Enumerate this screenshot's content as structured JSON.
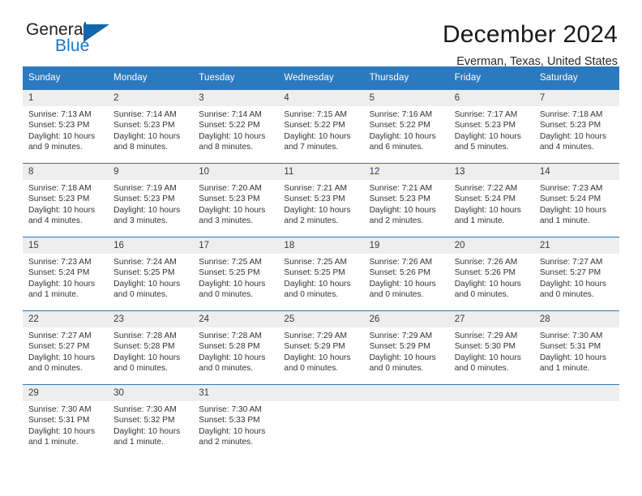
{
  "brand": {
    "name_top": "General",
    "name_bottom": "Blue",
    "accent_color": "#1878c8",
    "triangle_color": "#1266ac"
  },
  "header": {
    "title": "December 2024",
    "subtitle": "Everman, Texas, United States"
  },
  "theme": {
    "header_row_bg": "#2b79bf",
    "daynum_bg": "#eeeeee",
    "text_color": "#333333"
  },
  "weekday_headers": [
    "Sunday",
    "Monday",
    "Tuesday",
    "Wednesday",
    "Thursday",
    "Friday",
    "Saturday"
  ],
  "labels": {
    "sunrise_prefix": "Sunrise:",
    "sunset_prefix": "Sunset:",
    "daylight_prefix": "Daylight:"
  },
  "weeks": [
    {
      "days": [
        {
          "num": "1",
          "sunrise": "Sunrise: 7:13 AM",
          "sunset": "Sunset: 5:23 PM",
          "daylight_line1": "Daylight: 10 hours",
          "daylight_line2": "and 9 minutes."
        },
        {
          "num": "2",
          "sunrise": "Sunrise: 7:14 AM",
          "sunset": "Sunset: 5:23 PM",
          "daylight_line1": "Daylight: 10 hours",
          "daylight_line2": "and 8 minutes."
        },
        {
          "num": "3",
          "sunrise": "Sunrise: 7:14 AM",
          "sunset": "Sunset: 5:22 PM",
          "daylight_line1": "Daylight: 10 hours",
          "daylight_line2": "and 8 minutes."
        },
        {
          "num": "4",
          "sunrise": "Sunrise: 7:15 AM",
          "sunset": "Sunset: 5:22 PM",
          "daylight_line1": "Daylight: 10 hours",
          "daylight_line2": "and 7 minutes."
        },
        {
          "num": "5",
          "sunrise": "Sunrise: 7:16 AM",
          "sunset": "Sunset: 5:22 PM",
          "daylight_line1": "Daylight: 10 hours",
          "daylight_line2": "and 6 minutes."
        },
        {
          "num": "6",
          "sunrise": "Sunrise: 7:17 AM",
          "sunset": "Sunset: 5:23 PM",
          "daylight_line1": "Daylight: 10 hours",
          "daylight_line2": "and 5 minutes."
        },
        {
          "num": "7",
          "sunrise": "Sunrise: 7:18 AM",
          "sunset": "Sunset: 5:23 PM",
          "daylight_line1": "Daylight: 10 hours",
          "daylight_line2": "and 4 minutes."
        }
      ]
    },
    {
      "days": [
        {
          "num": "8",
          "sunrise": "Sunrise: 7:18 AM",
          "sunset": "Sunset: 5:23 PM",
          "daylight_line1": "Daylight: 10 hours",
          "daylight_line2": "and 4 minutes."
        },
        {
          "num": "9",
          "sunrise": "Sunrise: 7:19 AM",
          "sunset": "Sunset: 5:23 PM",
          "daylight_line1": "Daylight: 10 hours",
          "daylight_line2": "and 3 minutes."
        },
        {
          "num": "10",
          "sunrise": "Sunrise: 7:20 AM",
          "sunset": "Sunset: 5:23 PM",
          "daylight_line1": "Daylight: 10 hours",
          "daylight_line2": "and 3 minutes."
        },
        {
          "num": "11",
          "sunrise": "Sunrise: 7:21 AM",
          "sunset": "Sunset: 5:23 PM",
          "daylight_line1": "Daylight: 10 hours",
          "daylight_line2": "and 2 minutes."
        },
        {
          "num": "12",
          "sunrise": "Sunrise: 7:21 AM",
          "sunset": "Sunset: 5:23 PM",
          "daylight_line1": "Daylight: 10 hours",
          "daylight_line2": "and 2 minutes."
        },
        {
          "num": "13",
          "sunrise": "Sunrise: 7:22 AM",
          "sunset": "Sunset: 5:24 PM",
          "daylight_line1": "Daylight: 10 hours",
          "daylight_line2": "and 1 minute."
        },
        {
          "num": "14",
          "sunrise": "Sunrise: 7:23 AM",
          "sunset": "Sunset: 5:24 PM",
          "daylight_line1": "Daylight: 10 hours",
          "daylight_line2": "and 1 minute."
        }
      ]
    },
    {
      "days": [
        {
          "num": "15",
          "sunrise": "Sunrise: 7:23 AM",
          "sunset": "Sunset: 5:24 PM",
          "daylight_line1": "Daylight: 10 hours",
          "daylight_line2": "and 1 minute."
        },
        {
          "num": "16",
          "sunrise": "Sunrise: 7:24 AM",
          "sunset": "Sunset: 5:25 PM",
          "daylight_line1": "Daylight: 10 hours",
          "daylight_line2": "and 0 minutes."
        },
        {
          "num": "17",
          "sunrise": "Sunrise: 7:25 AM",
          "sunset": "Sunset: 5:25 PM",
          "daylight_line1": "Daylight: 10 hours",
          "daylight_line2": "and 0 minutes."
        },
        {
          "num": "18",
          "sunrise": "Sunrise: 7:25 AM",
          "sunset": "Sunset: 5:25 PM",
          "daylight_line1": "Daylight: 10 hours",
          "daylight_line2": "and 0 minutes."
        },
        {
          "num": "19",
          "sunrise": "Sunrise: 7:26 AM",
          "sunset": "Sunset: 5:26 PM",
          "daylight_line1": "Daylight: 10 hours",
          "daylight_line2": "and 0 minutes."
        },
        {
          "num": "20",
          "sunrise": "Sunrise: 7:26 AM",
          "sunset": "Sunset: 5:26 PM",
          "daylight_line1": "Daylight: 10 hours",
          "daylight_line2": "and 0 minutes."
        },
        {
          "num": "21",
          "sunrise": "Sunrise: 7:27 AM",
          "sunset": "Sunset: 5:27 PM",
          "daylight_line1": "Daylight: 10 hours",
          "daylight_line2": "and 0 minutes."
        }
      ]
    },
    {
      "days": [
        {
          "num": "22",
          "sunrise": "Sunrise: 7:27 AM",
          "sunset": "Sunset: 5:27 PM",
          "daylight_line1": "Daylight: 10 hours",
          "daylight_line2": "and 0 minutes."
        },
        {
          "num": "23",
          "sunrise": "Sunrise: 7:28 AM",
          "sunset": "Sunset: 5:28 PM",
          "daylight_line1": "Daylight: 10 hours",
          "daylight_line2": "and 0 minutes."
        },
        {
          "num": "24",
          "sunrise": "Sunrise: 7:28 AM",
          "sunset": "Sunset: 5:28 PM",
          "daylight_line1": "Daylight: 10 hours",
          "daylight_line2": "and 0 minutes."
        },
        {
          "num": "25",
          "sunrise": "Sunrise: 7:29 AM",
          "sunset": "Sunset: 5:29 PM",
          "daylight_line1": "Daylight: 10 hours",
          "daylight_line2": "and 0 minutes."
        },
        {
          "num": "26",
          "sunrise": "Sunrise: 7:29 AM",
          "sunset": "Sunset: 5:29 PM",
          "daylight_line1": "Daylight: 10 hours",
          "daylight_line2": "and 0 minutes."
        },
        {
          "num": "27",
          "sunrise": "Sunrise: 7:29 AM",
          "sunset": "Sunset: 5:30 PM",
          "daylight_line1": "Daylight: 10 hours",
          "daylight_line2": "and 0 minutes."
        },
        {
          "num": "28",
          "sunrise": "Sunrise: 7:30 AM",
          "sunset": "Sunset: 5:31 PM",
          "daylight_line1": "Daylight: 10 hours",
          "daylight_line2": "and 1 minute."
        }
      ]
    },
    {
      "days": [
        {
          "num": "29",
          "sunrise": "Sunrise: 7:30 AM",
          "sunset": "Sunset: 5:31 PM",
          "daylight_line1": "Daylight: 10 hours",
          "daylight_line2": "and 1 minute."
        },
        {
          "num": "30",
          "sunrise": "Sunrise: 7:30 AM",
          "sunset": "Sunset: 5:32 PM",
          "daylight_line1": "Daylight: 10 hours",
          "daylight_line2": "and 1 minute."
        },
        {
          "num": "31",
          "sunrise": "Sunrise: 7:30 AM",
          "sunset": "Sunset: 5:33 PM",
          "daylight_line1": "Daylight: 10 hours",
          "daylight_line2": "and 2 minutes."
        },
        {
          "num": "",
          "sunrise": "",
          "sunset": "",
          "daylight_line1": "",
          "daylight_line2": ""
        },
        {
          "num": "",
          "sunrise": "",
          "sunset": "",
          "daylight_line1": "",
          "daylight_line2": ""
        },
        {
          "num": "",
          "sunrise": "",
          "sunset": "",
          "daylight_line1": "",
          "daylight_line2": ""
        },
        {
          "num": "",
          "sunrise": "",
          "sunset": "",
          "daylight_line1": "",
          "daylight_line2": ""
        }
      ]
    }
  ]
}
